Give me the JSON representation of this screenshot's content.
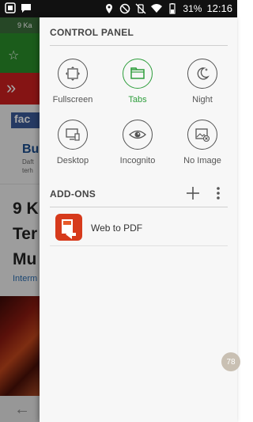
{
  "status_bar": {
    "battery": "31%",
    "time": "12:16"
  },
  "background_page": {
    "tab_text": "9 Ka",
    "fb_text": "fac",
    "headline_short": "Bu",
    "snippet1": "Daft",
    "snippet2": "terh",
    "big_line1": "9 K",
    "big_line2": "Ter",
    "big_line3": "Mu",
    "link_text": "Interm"
  },
  "control_panel": {
    "title": "CONTROL PANEL",
    "tiles": [
      {
        "label": "Fullscreen",
        "icon": "fullscreen-icon",
        "active": false
      },
      {
        "label": "Tabs",
        "icon": "tabs-icon",
        "active": true
      },
      {
        "label": "Night",
        "icon": "night-icon",
        "active": false
      },
      {
        "label": "Desktop",
        "icon": "desktop-icon",
        "active": false
      },
      {
        "label": "Incognito",
        "icon": "incognito-icon",
        "active": false
      },
      {
        "label": "No Image",
        "icon": "no-image-icon",
        "active": false
      }
    ]
  },
  "addons": {
    "title": "ADD-ONS",
    "items": [
      {
        "label": "Web to PDF",
        "icon": "web-to-pdf-icon"
      }
    ]
  },
  "scroll_badge": "78",
  "colors": {
    "accent": "#2e9e3c",
    "icon_stroke": "#555555",
    "panel_bg": "#f7f7f7"
  }
}
